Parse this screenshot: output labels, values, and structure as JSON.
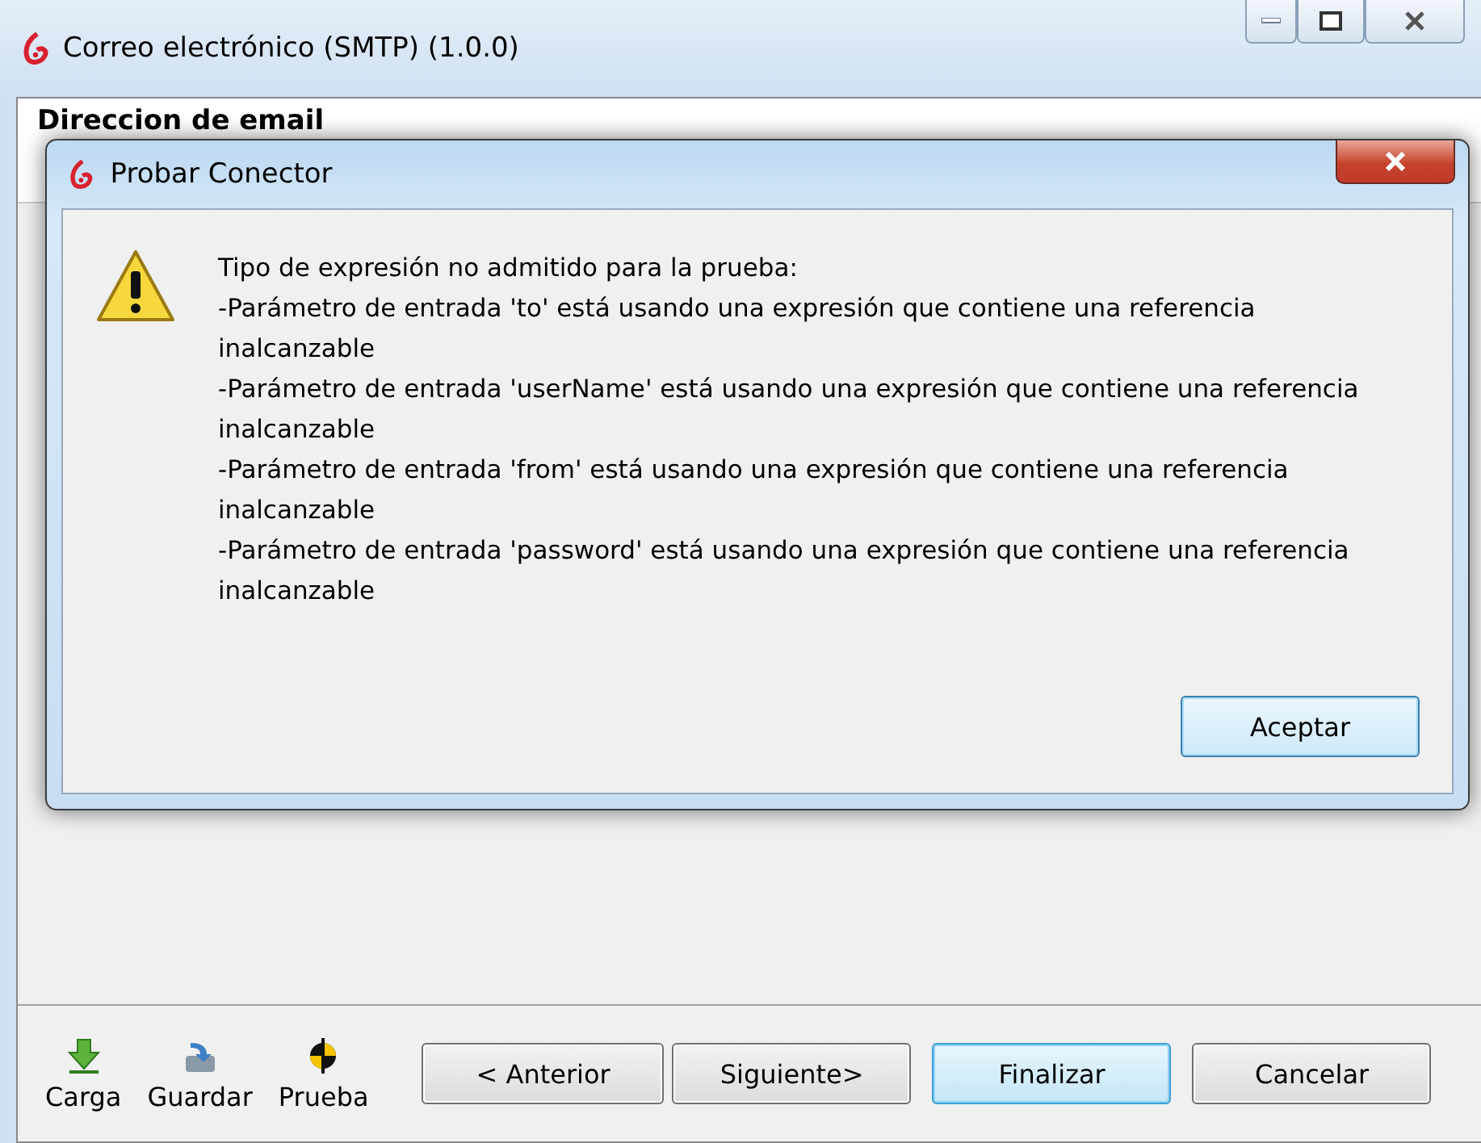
{
  "window": {
    "title": "Correo electrónico (SMTP) (1.0.0)"
  },
  "page": {
    "heading": "Direccion de email"
  },
  "dialog": {
    "title": "Probar Conector",
    "message": [
      "Tipo de expresión no admitido para la prueba:",
      "-Parámetro de entrada 'to' está usando una expresión que contiene una referencia inalcanzable",
      "-Parámetro de entrada 'userName' está usando una expresión que contiene una referencia inalcanzable",
      "-Parámetro de entrada 'from' está usando una expresión que contiene una referencia inalcanzable",
      "-Parámetro de entrada 'password' está usando una expresión que contiene una referencia inalcanzable"
    ],
    "button": "Aceptar"
  },
  "footer": {
    "tools": [
      {
        "label": "Carga",
        "kind": "load"
      },
      {
        "label": "Guardar",
        "kind": "save"
      },
      {
        "label": "Prueba",
        "kind": "test"
      }
    ],
    "buttons": [
      {
        "label": "< Anterior",
        "selected": false
      },
      {
        "label": "Siguiente>",
        "selected": false
      },
      {
        "label": "Finalizar",
        "selected": true
      },
      {
        "label": "Cancelar",
        "selected": false
      }
    ]
  }
}
